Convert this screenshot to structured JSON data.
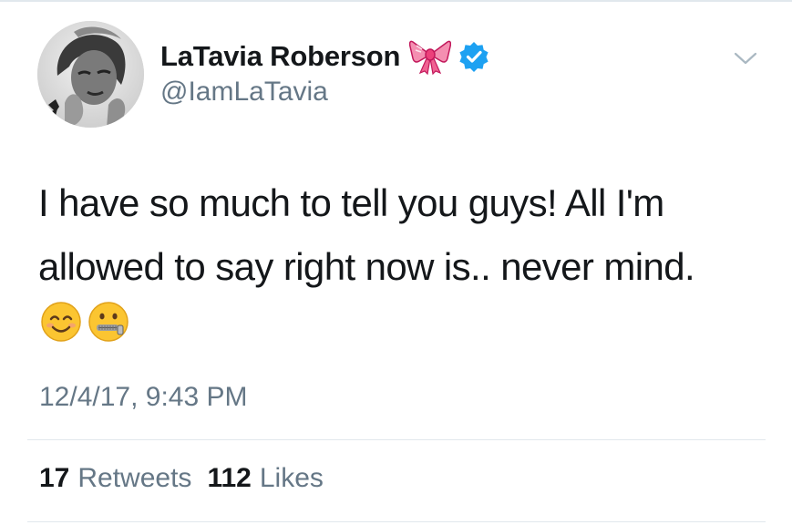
{
  "user": {
    "display_name": "LaTavia Roberson",
    "handle": "@IamLaTavia",
    "badge_icons": [
      "bow-emoji-icon",
      "verified-badge-icon"
    ]
  },
  "tweet": {
    "text": "I have so much to tell you guys! All I'm\nallowed to say right now is.. never mind.",
    "emojis": [
      "smiling-face-icon",
      "zipper-mouth-face-icon"
    ],
    "timestamp": "12/4/17, 9:43 PM"
  },
  "stats": {
    "retweets_count": "17",
    "retweets_label": "Retweets",
    "likes_count": "112",
    "likes_label": "Likes"
  },
  "colors": {
    "text_primary": "#14171a",
    "text_secondary": "#657786",
    "verified_blue": "#1da1f2",
    "divider": "#e1e8ed"
  }
}
